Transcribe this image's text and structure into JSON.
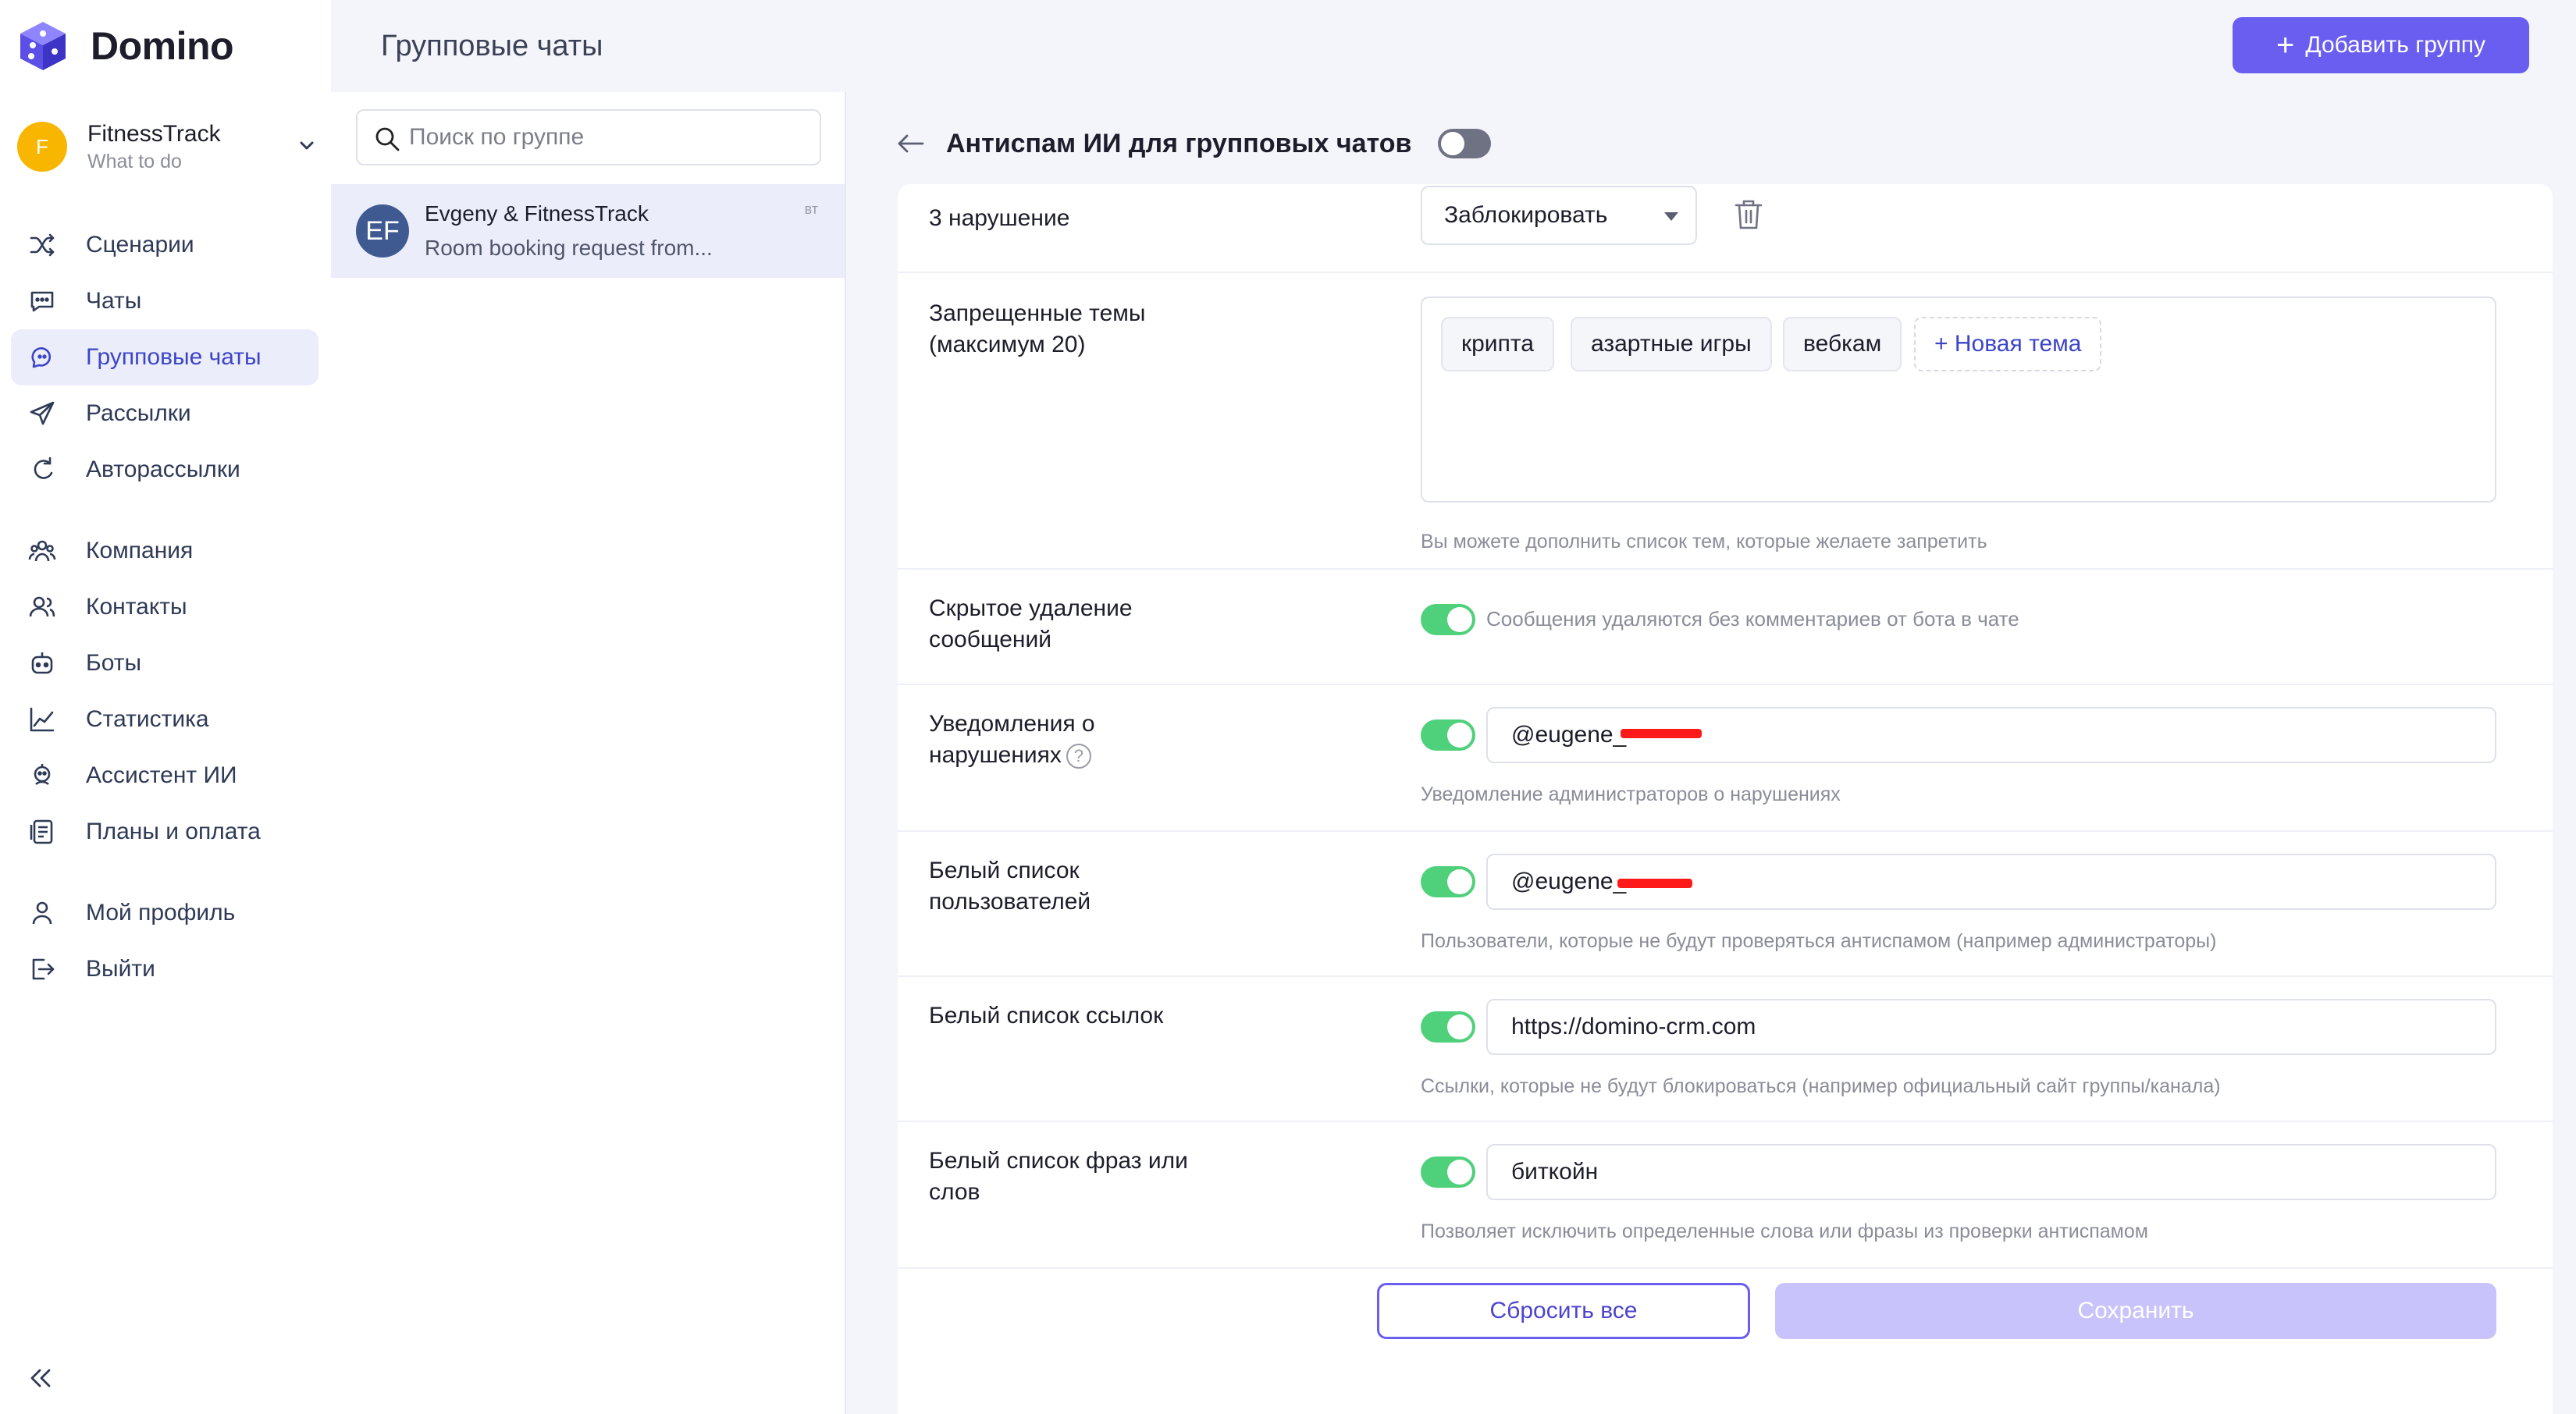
{
  "brand": {
    "name": "Domino",
    "accent": "#6a5ef0"
  },
  "account": {
    "initial": "F",
    "name": "FitnessTrack",
    "subtitle": "What to do"
  },
  "nav": {
    "group1": [
      {
        "label": "Сценарии",
        "icon": "shuffle-icon"
      },
      {
        "label": "Чаты",
        "icon": "chat-bubble-icon"
      },
      {
        "label": "Групповые чаты",
        "icon": "group-chat-icon",
        "active": true
      },
      {
        "label": "Рассылки",
        "icon": "send-icon"
      },
      {
        "label": "Авторассылки",
        "icon": "auto-send-icon"
      }
    ],
    "group2": [
      {
        "label": "Компания",
        "icon": "company-icon"
      },
      {
        "label": "Контакты",
        "icon": "contacts-icon"
      },
      {
        "label": "Боты",
        "icon": "bot-icon"
      },
      {
        "label": "Статистика",
        "icon": "chart-line-icon"
      },
      {
        "label": "Ассистент ИИ",
        "icon": "ai-assistant-icon"
      },
      {
        "label": "Планы и оплата",
        "icon": "billing-icon"
      }
    ],
    "group3": [
      {
        "label": "Мой профиль",
        "icon": "user-icon"
      },
      {
        "label": "Выйти",
        "icon": "logout-icon"
      }
    ]
  },
  "header": {
    "title": "Групповые чаты",
    "add_button": "Добавить группу"
  },
  "search": {
    "placeholder": "Поиск по группе",
    "value": ""
  },
  "chats": [
    {
      "initials": "EF",
      "name": "Evgeny & FitnessTrack",
      "preview": "Room booking request from...",
      "time": "вт"
    }
  ],
  "panel": {
    "title": "Антиспам ИИ для групповых чатов",
    "enabled": false,
    "violation3": {
      "label": "3 нарушение",
      "action": "Заблокировать"
    },
    "topics": {
      "label": "Запрещенные темы (максимум 20)",
      "tags": [
        "крипта",
        "азартные игры",
        "вебкам"
      ],
      "new_tag": "+ Новая тема",
      "hint": "Вы можете дополнить список тем, которые желаете запретить"
    },
    "hidden_delete": {
      "label": "Скрытое удаление сообщений",
      "enabled": true,
      "note": "Сообщения удаляются без комментариев от бота в чате"
    },
    "notifications": {
      "label": "Уведомления о нарушениях",
      "enabled": true,
      "value": "@eugene_",
      "hint": "Уведомление администраторов о нарушениях"
    },
    "whitelist_users": {
      "label": "Белый список пользователей",
      "enabled": true,
      "value": "@eugene_",
      "hint": "Пользователи, которые не будут проверяться антиспамом (например администраторы)"
    },
    "whitelist_links": {
      "label": "Белый список ссылок",
      "enabled": true,
      "value": "https://domino-crm.com",
      "hint": "Ссылки, которые не будут блокироваться (например официальный сайт группы/канала)"
    },
    "whitelist_words": {
      "label": "Белый список фраз или слов",
      "enabled": true,
      "value": "биткойн",
      "hint": "Позволяет исключить определенные слова или фразы из проверки антиспамом"
    },
    "reset_button": "Сбросить все",
    "save_button": "Сохранить"
  }
}
